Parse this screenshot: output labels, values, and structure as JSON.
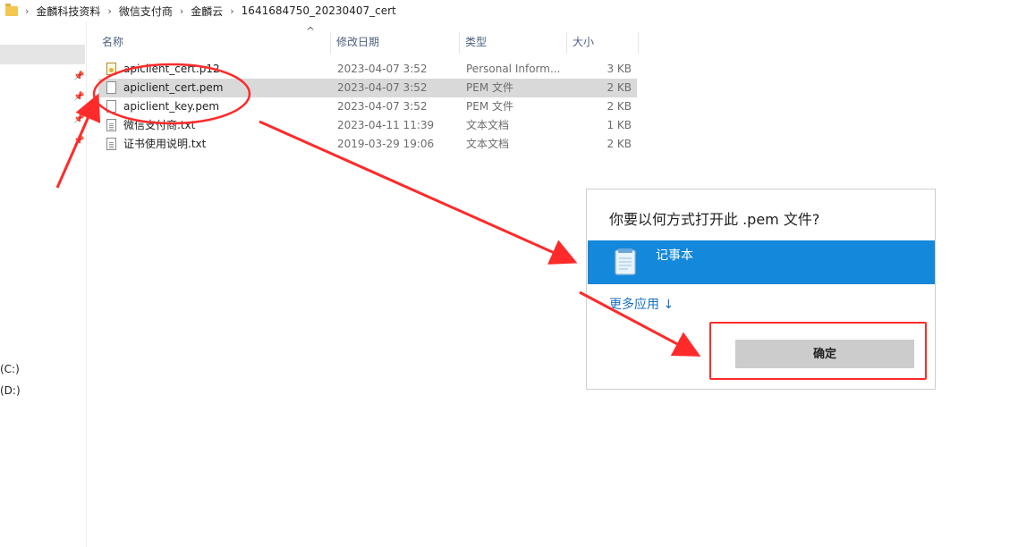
{
  "breadcrumb": [
    "金麟科技资料",
    "微信支付商",
    "金麟云",
    "1641684750_20230407_cert"
  ],
  "nav": {
    "drives": [
      "(C:)",
      "(D:)"
    ]
  },
  "columns": {
    "name": "名称",
    "date": "修改日期",
    "type": "类型",
    "size": "大小"
  },
  "files": [
    {
      "name": "apiclient_cert.p12",
      "date": "2023-04-07 3:52",
      "type": "Personal Inform...",
      "size": "3 KB",
      "icon": "certificate-file-icon"
    },
    {
      "name": "apiclient_cert.pem",
      "date": "2023-04-07 3:52",
      "type": "PEM 文件",
      "size": "2 KB",
      "icon": "file-icon"
    },
    {
      "name": "apiclient_key.pem",
      "date": "2023-04-07 3:52",
      "type": "PEM 文件",
      "size": "2 KB",
      "icon": "file-icon"
    },
    {
      "name": "微信支付商.txt",
      "date": "2023-04-11 11:39",
      "type": "文本文档",
      "size": "1 KB",
      "icon": "text-file-icon"
    },
    {
      "name": "证书使用说明.txt",
      "date": "2019-03-29 19:06",
      "type": "文本文档",
      "size": "2 KB",
      "icon": "text-file-icon"
    }
  ],
  "dialog": {
    "title": "你要以何方式打开此 .pem 文件?",
    "app_option": "记事本",
    "more_apps": "更多应用 ↓",
    "ok_label": "确定"
  },
  "colors": {
    "accent": "#1488db",
    "annotation": "#ff2a2a",
    "selected_row": "#d9d9d9"
  }
}
